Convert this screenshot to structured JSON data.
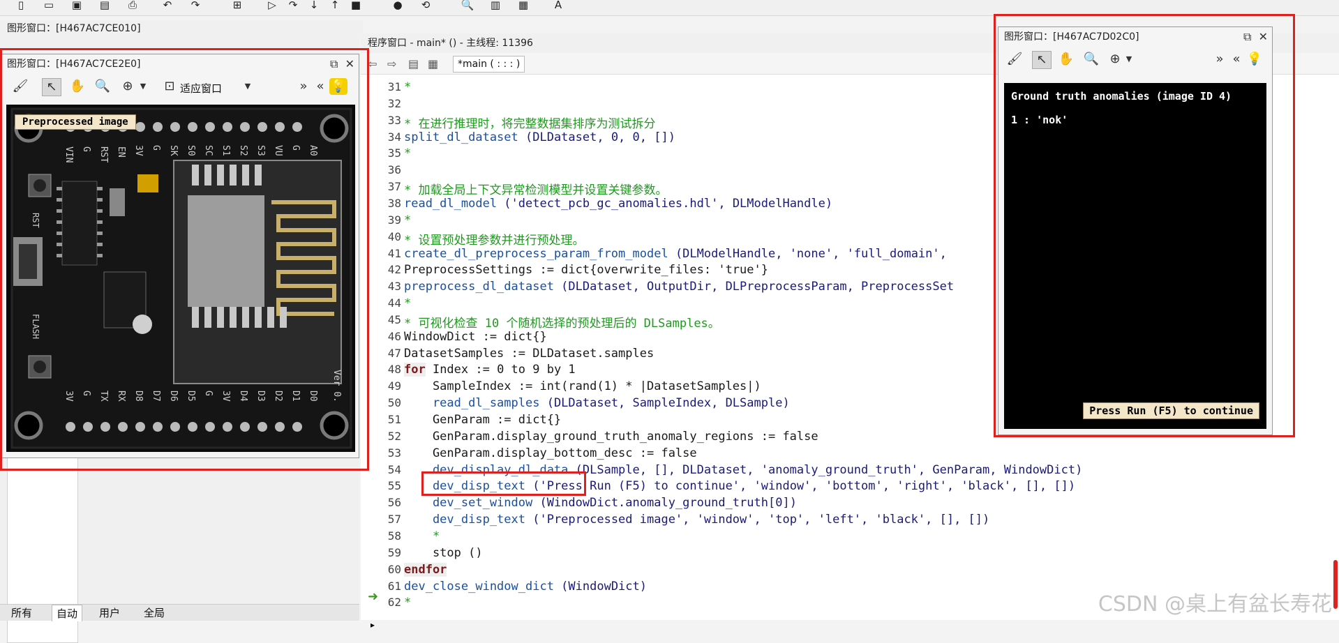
{
  "top_toolbar": {
    "icons": [
      "new-file-icon",
      "open-file-icon",
      "save-icon",
      "save-as-icon",
      "print-icon",
      "undo-icon",
      "redo-icon",
      "insert-icon",
      "run-icon",
      "step-over-icon",
      "step-into-icon",
      "step-out-icon",
      "stop-icon",
      "breakpoint-icon",
      "reset-icon",
      "zoom-icon",
      "chart-icon",
      "image-icon",
      "text-icon"
    ]
  },
  "background_graphics_window": {
    "title": "图形窗口：[H467AC7CE010]"
  },
  "left_bottom_tabs": [
    "所有",
    "自动",
    "用户",
    "全局"
  ],
  "program_window": {
    "title": "程序窗口 - main* () - 主线程: 11396",
    "procedure_tab": "*main ( : : : )",
    "watermark": "CSDN @桌上有盆长寿花",
    "lines": [
      {
        "n": "31",
        "segs": [
          {
            "t": "*",
            "c": "cmt"
          }
        ]
      },
      {
        "n": "32",
        "segs": []
      },
      {
        "n": "33",
        "segs": [
          {
            "t": "* 在进行推理时，将完整数据集排序为测试拆分",
            "c": "cmt"
          }
        ]
      },
      {
        "n": "34",
        "segs": [
          {
            "t": "split_dl_dataset",
            "c": "op"
          },
          {
            "t": " (DLDataset, 0, 0, [])",
            "c": "str"
          }
        ]
      },
      {
        "n": "35",
        "segs": [
          {
            "t": "*",
            "c": "cmt"
          }
        ]
      },
      {
        "n": "36",
        "segs": []
      },
      {
        "n": "37",
        "segs": [
          {
            "t": "* 加载全局上下文异常检测模型并设置关键参数。",
            "c": "cmt"
          }
        ]
      },
      {
        "n": "38",
        "segs": [
          {
            "t": "read_dl_model",
            "c": "op"
          },
          {
            "t": " ('detect_pcb_gc_anomalies.hdl', DLModelHandle)",
            "c": "str"
          }
        ]
      },
      {
        "n": "39",
        "segs": [
          {
            "t": "*",
            "c": "cmt"
          }
        ]
      },
      {
        "n": "40",
        "segs": [
          {
            "t": "* 设置预处理参数并进行预处理。",
            "c": "cmt"
          }
        ]
      },
      {
        "n": "41",
        "segs": [
          {
            "t": "create_dl_preprocess_param_from_model",
            "c": "op"
          },
          {
            "t": " (DLModelHandle, 'none', 'full_domain',",
            "c": "str"
          }
        ]
      },
      {
        "n": "42",
        "segs": [
          {
            "t": "PreprocessSettings := dict{overwrite_files: 'true'}",
            "c": "bt"
          }
        ]
      },
      {
        "n": "43",
        "segs": [
          {
            "t": "preprocess_dl_dataset",
            "c": "op"
          },
          {
            "t": " (DLDataset, OutputDir, DLPreprocessParam, PreprocessSet",
            "c": "str"
          }
        ]
      },
      {
        "n": "44",
        "segs": [
          {
            "t": "*",
            "c": "cmt"
          }
        ]
      },
      {
        "n": "45",
        "segs": [
          {
            "t": "* 可视化检查 ",
            "c": "cmt"
          },
          {
            "t": "10",
            "c": "cmt"
          },
          {
            "t": " 个随机选择的预处理后的 DLSamples。",
            "c": "cmt"
          }
        ]
      },
      {
        "n": "46",
        "segs": [
          {
            "t": "WindowDict := dict{}",
            "c": "bt"
          }
        ]
      },
      {
        "n": "47",
        "segs": [
          {
            "t": "DatasetSamples := DLDataset.samples",
            "c": "bt"
          }
        ]
      },
      {
        "n": "48",
        "segs": [
          {
            "t": "for",
            "c": "kw"
          },
          {
            "t": " Index := 0 to 9 by 1",
            "c": "bt"
          }
        ]
      },
      {
        "n": "49",
        "segs": [
          {
            "t": "    SampleIndex := int(rand(1) * |DatasetSamples|)",
            "c": "bt"
          }
        ]
      },
      {
        "n": "50",
        "segs": [
          {
            "t": "    read_dl_samples",
            "c": "op"
          },
          {
            "t": " (DLDataset, SampleIndex, DLSample)",
            "c": "str"
          }
        ]
      },
      {
        "n": "51",
        "segs": [
          {
            "t": "    GenParam := dict{}",
            "c": "bt"
          }
        ]
      },
      {
        "n": "52",
        "segs": [
          {
            "t": "    GenParam.display_ground_truth_anomaly_regions := false",
            "c": "bt"
          }
        ]
      },
      {
        "n": "53",
        "segs": [
          {
            "t": "    GenParam.display_bottom_desc := false",
            "c": "bt"
          }
        ]
      },
      {
        "n": "54",
        "segs": [
          {
            "t": "    dev_display_dl_data",
            "c": "op"
          },
          {
            "t": " (DLSample, [], DLDataset, 'anomaly_ground_truth', GenParam, WindowDict)",
            "c": "str"
          }
        ]
      },
      {
        "n": "55",
        "segs": [
          {
            "t": "    dev_disp_text",
            "c": "op"
          },
          {
            "t": " ('Press Run (F5) to continue', 'window', 'bottom', 'right', 'black', [], [])",
            "c": "str"
          }
        ]
      },
      {
        "n": "56",
        "segs": [
          {
            "t": "    dev_set_window",
            "c": "op"
          },
          {
            "t": " (WindowDict.anomaly_ground_truth[0])",
            "c": "str"
          }
        ]
      },
      {
        "n": "57",
        "segs": [
          {
            "t": "    dev_disp_text",
            "c": "op"
          },
          {
            "t": " ('Preprocessed image', 'window', 'top', 'left', 'black', [], [])",
            "c": "str"
          }
        ]
      },
      {
        "n": "58",
        "segs": [
          {
            "t": "    *",
            "c": "cmt"
          }
        ]
      },
      {
        "n": "59",
        "segs": [
          {
            "t": "    stop ()",
            "c": "bt"
          }
        ]
      },
      {
        "n": "60",
        "segs": [
          {
            "t": "endfor",
            "c": "kw"
          }
        ]
      },
      {
        "n": "61",
        "segs": [
          {
            "t": "dev_close_window_dict",
            "c": "op"
          },
          {
            "t": " (WindowDict)",
            "c": "str"
          }
        ]
      },
      {
        "n": "62",
        "segs": [
          {
            "t": "*",
            "c": "cmt"
          }
        ]
      }
    ]
  },
  "graphics_window_left": {
    "title": "图形窗口：[H467AC7CE2E0]",
    "fit_label": "适应窗口",
    "image_label": "Preprocessed image",
    "pcb_silk_top": [
      "A0",
      "G",
      "VU",
      "S3",
      "S2",
      "S1",
      "SC",
      "S0",
      "SK",
      "G",
      "3V"
    ],
    "pcb_silk_top_left": [
      "VIN",
      "G",
      "RST",
      "EN"
    ],
    "pcb_silk_bottom": [
      "3V",
      "G",
      "TX",
      "RX",
      "D8",
      "D7",
      "D6",
      "D5",
      "G",
      "3V",
      "D4",
      "D3",
      "D2",
      "D1",
      "D0"
    ],
    "pcb_labels": {
      "rst": "RST",
      "flash": "FLASH",
      "ver": "Ver 0."
    }
  },
  "graphics_window_right": {
    "title": "图形窗口：[H467AC7D02C0]",
    "heading": "Ground truth anomalies (image ID 4)",
    "entry": "1 : 'nok'",
    "continue_text": "Press Run (F5) to continue"
  }
}
